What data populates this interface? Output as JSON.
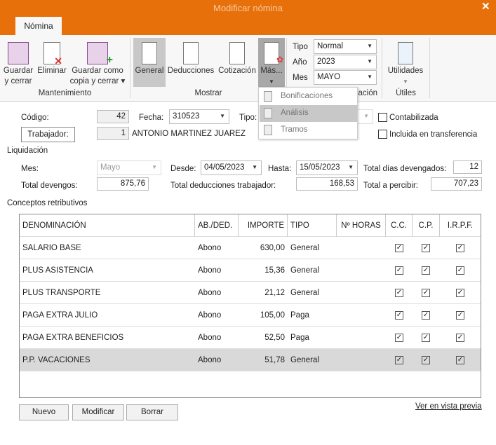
{
  "window": {
    "title": "Modificar nómina",
    "close": "✕"
  },
  "ribbon": {
    "tab": "Nómina",
    "buttons": {
      "guardar": "Guardar\ny cerrar",
      "eliminar": "Eliminar",
      "guardar_copia": "Guardar como\ncopia y cerrar ▾",
      "general": "General",
      "deducciones": "Deducciones",
      "cotizacion": "Cotización",
      "mas": "Más...",
      "utilidades": "Utilidades"
    },
    "groups": {
      "mantenimiento": "Mantenimiento",
      "mostrar": "Mostrar",
      "liquidacion": "Liquidación",
      "utiles": "Útiles"
    },
    "tipo_label": "Tipo",
    "tipo_value": "Normal",
    "anio_label": "Año",
    "anio_value": "2023",
    "mes_label": "Mes",
    "mes_value": "MAYO"
  },
  "menu": {
    "items": [
      "Bonificaciones",
      "Análisis",
      "Tramos"
    ],
    "highlighted": "Análisis"
  },
  "form": {
    "codigo_label": "Código:",
    "codigo": "42",
    "fecha_label": "Fecha:",
    "fecha": "310523",
    "tipo_label": "Tipo:",
    "trabajador_button": "Trabajador:",
    "trabajador_id": "1",
    "trabajador_nombre": "ANTONIO MARTINEZ JUAREZ",
    "contabilizada": "Contabilizada",
    "transferencia": "Incluida en transferencia",
    "liquidacion_title": "Liquidación",
    "mes_label": "Mes:",
    "mes": "Mayo",
    "desde_label": "Desde:",
    "desde": "04/05/2023",
    "hasta_label": "Hasta:",
    "hasta": "15/05/2023",
    "dias_label": "Total días devengados:",
    "dias": "12",
    "devengos_label": "Total devengos:",
    "devengos": "875,76",
    "deducciones_label": "Total deducciones trabajador:",
    "deducciones": "168,53",
    "percibir_label": "Total a percibir:",
    "percibir": "707,23",
    "conceptos_title": "Conceptos retributivos"
  },
  "table": {
    "headers": [
      "DENOMINACIÓN",
      "AB./DED.",
      "IMPORTE",
      "TIPO",
      "Nº HORAS",
      "C.C.",
      "C.P.",
      "I.R.P.F."
    ],
    "rows": [
      {
        "denominacion": "SALARIO BASE",
        "ab": "Abono",
        "importe": "630,00",
        "tipo": "General",
        "horas": "",
        "cc": true,
        "cp": true,
        "irpf": true
      },
      {
        "denominacion": "PLUS ASISTENCIA",
        "ab": "Abono",
        "importe": "15,36",
        "tipo": "General",
        "horas": "",
        "cc": true,
        "cp": true,
        "irpf": true
      },
      {
        "denominacion": "PLUS TRANSPORTE",
        "ab": "Abono",
        "importe": "21,12",
        "tipo": "General",
        "horas": "",
        "cc": true,
        "cp": true,
        "irpf": true
      },
      {
        "denominacion": "PAGA EXTRA JULIO",
        "ab": "Abono",
        "importe": "105,00",
        "tipo": "Paga",
        "horas": "",
        "cc": true,
        "cp": true,
        "irpf": true
      },
      {
        "denominacion": "PAGA EXTRA BENEFICIOS",
        "ab": "Abono",
        "importe": "52,50",
        "tipo": "Paga",
        "horas": "",
        "cc": true,
        "cp": true,
        "irpf": true
      },
      {
        "denominacion": "P.P. VACACIONES",
        "ab": "Abono",
        "importe": "51,78",
        "tipo": "General",
        "horas": "",
        "cc": true,
        "cp": true,
        "irpf": true
      }
    ],
    "selected_row": 5
  },
  "footer": {
    "nuevo": "Nuevo",
    "modificar": "Modificar",
    "borrar": "Borrar",
    "vista_previa": "Ver en vista previa"
  },
  "colors": {
    "accent": "#E8700A",
    "selected_row": "#d9d9d9"
  }
}
